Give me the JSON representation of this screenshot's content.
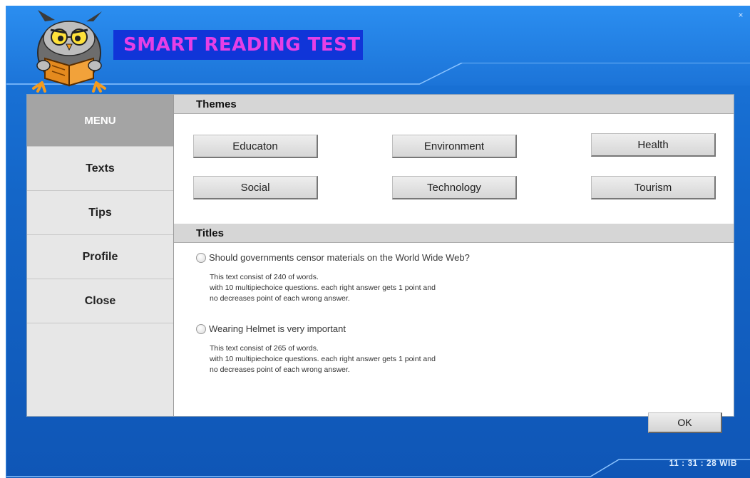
{
  "window": {
    "title": "SMART READING TEST",
    "close_glyph": "×"
  },
  "sidebar": {
    "items": [
      {
        "label": "MENU"
      },
      {
        "label": "Texts"
      },
      {
        "label": "Tips"
      },
      {
        "label": "Profile"
      },
      {
        "label": "Close"
      }
    ]
  },
  "themes": {
    "header": "Themes",
    "buttons": [
      "Educaton",
      "Environment",
      "Health",
      "Social",
      "Technology",
      "Tourism"
    ]
  },
  "titles": {
    "header": "Titles",
    "items": [
      {
        "label": "Should governments censor materials on the World Wide Web?",
        "desc": [
          "This text consist of 240 of words.",
          "with 10 multipiechoice questions. each right answer gets 1 point and",
          "no decreases point of each wrong answer."
        ]
      },
      {
        "label": "Wearing Helmet is very important",
        "desc": [
          "This text consist of 265 of words.",
          "with 10 multipiechoice questions. each right answer gets 1 point and",
          "no decreases point of each wrong answer."
        ]
      }
    ],
    "ok_label": "OK"
  },
  "status": {
    "clock": "11 : 31 : 28  WIB"
  },
  "colors": {
    "window_bg": "#1466c8",
    "title_bg": "#1035d8",
    "title_text": "#e63fe6",
    "menu_active_bg": "#a4a4a4"
  },
  "icons": [
    "owl-reading-book-logo",
    "close-icon",
    "radio-icon"
  ]
}
